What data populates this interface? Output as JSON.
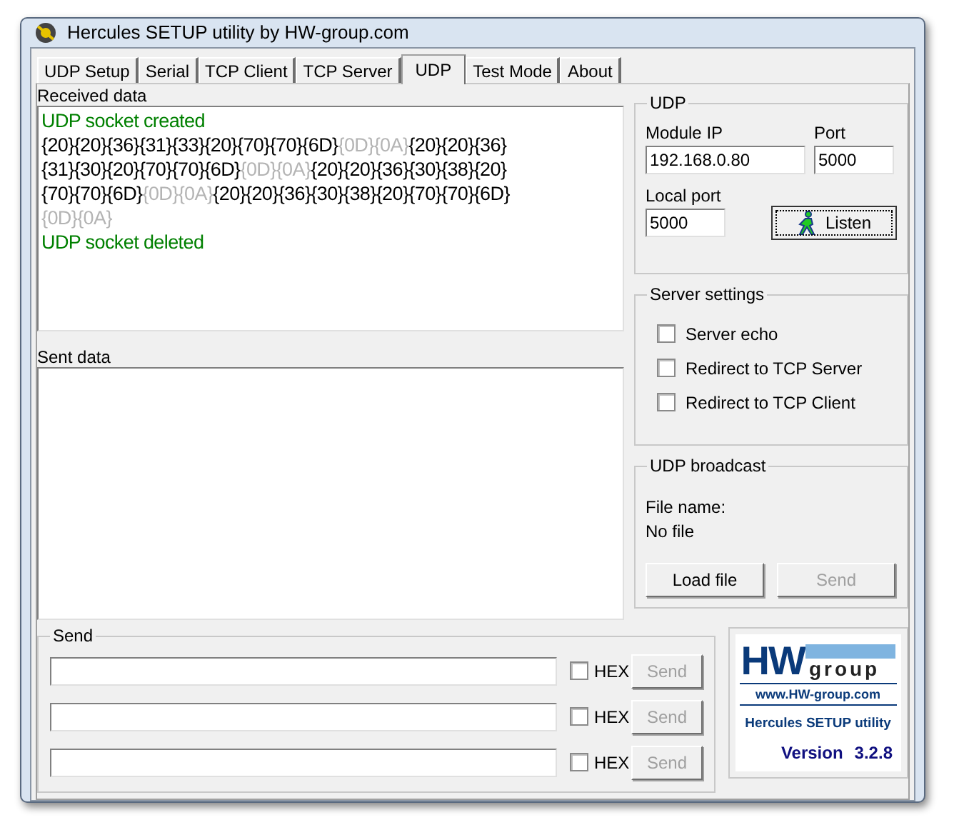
{
  "window": {
    "title": "Hercules SETUP utility by HW-group.com"
  },
  "tabs": [
    {
      "label": "UDP Setup",
      "selected": false
    },
    {
      "label": "Serial",
      "selected": false
    },
    {
      "label": "TCP Client",
      "selected": false
    },
    {
      "label": "TCP Server",
      "selected": false
    },
    {
      "label": "UDP",
      "selected": true
    },
    {
      "label": "Test Mode",
      "selected": false
    },
    {
      "label": "About",
      "selected": false
    }
  ],
  "received": {
    "label": "Received data",
    "lines": [
      {
        "kind": "status",
        "text": "UDP socket created"
      },
      {
        "kind": "data",
        "segments": [
          {
            "text": "{20}{20}{36}{31}{33}{20}{70}{70}{6D}",
            "control": false
          },
          {
            "text": "{0D}{0A}",
            "control": true
          },
          {
            "text": "{20}{20}{36}",
            "control": false
          }
        ]
      },
      {
        "kind": "data",
        "segments": [
          {
            "text": "{31}{30}{20}{70}{70}{6D}",
            "control": false
          },
          {
            "text": "{0D}{0A}",
            "control": true
          },
          {
            "text": "{20}{20}{36}{30}{38}{20}",
            "control": false
          }
        ]
      },
      {
        "kind": "data",
        "segments": [
          {
            "text": "{70}{70}{6D}",
            "control": false
          },
          {
            "text": "{0D}{0A}",
            "control": true
          },
          {
            "text": "{20}{20}{36}{30}{38}{20}{70}{70}{6D}",
            "control": false
          }
        ]
      },
      {
        "kind": "data",
        "segments": [
          {
            "text": "{0D}{0A}",
            "control": true
          }
        ]
      },
      {
        "kind": "status",
        "text": "UDP socket deleted"
      }
    ]
  },
  "sent": {
    "label": "Sent data"
  },
  "udp": {
    "title": "UDP",
    "module_ip_label": "Module IP",
    "module_ip": "192.168.0.80",
    "port_label": "Port",
    "port": "5000",
    "local_port_label": "Local port",
    "local_port": "5000",
    "listen_button": "Listen"
  },
  "server_settings": {
    "title": "Server settings",
    "options": [
      {
        "label": "Server echo",
        "checked": false
      },
      {
        "label": "Redirect to TCP Server",
        "checked": false
      },
      {
        "label": "Redirect to TCP Client",
        "checked": false
      }
    ]
  },
  "broadcast": {
    "title": "UDP broadcast",
    "file_name_label": "File name:",
    "file_name": "No file",
    "load_button": {
      "label": "Load file",
      "disabled": false
    },
    "send_button": {
      "label": "Send",
      "disabled": true
    }
  },
  "send": {
    "title": "Send",
    "rows": [
      {
        "hex_label": "HEX",
        "hex": false,
        "button": "Send",
        "disabled": true
      },
      {
        "hex_label": "HEX",
        "hex": false,
        "button": "Send",
        "disabled": true
      },
      {
        "hex_label": "HEX",
        "hex": false,
        "button": "Send",
        "disabled": true
      }
    ]
  },
  "logo": {
    "mark": "HW",
    "group": "group",
    "url": "www.HW-group.com",
    "product": "Hercules SETUP utility",
    "version_label": "Version",
    "version": "3.2.8"
  }
}
